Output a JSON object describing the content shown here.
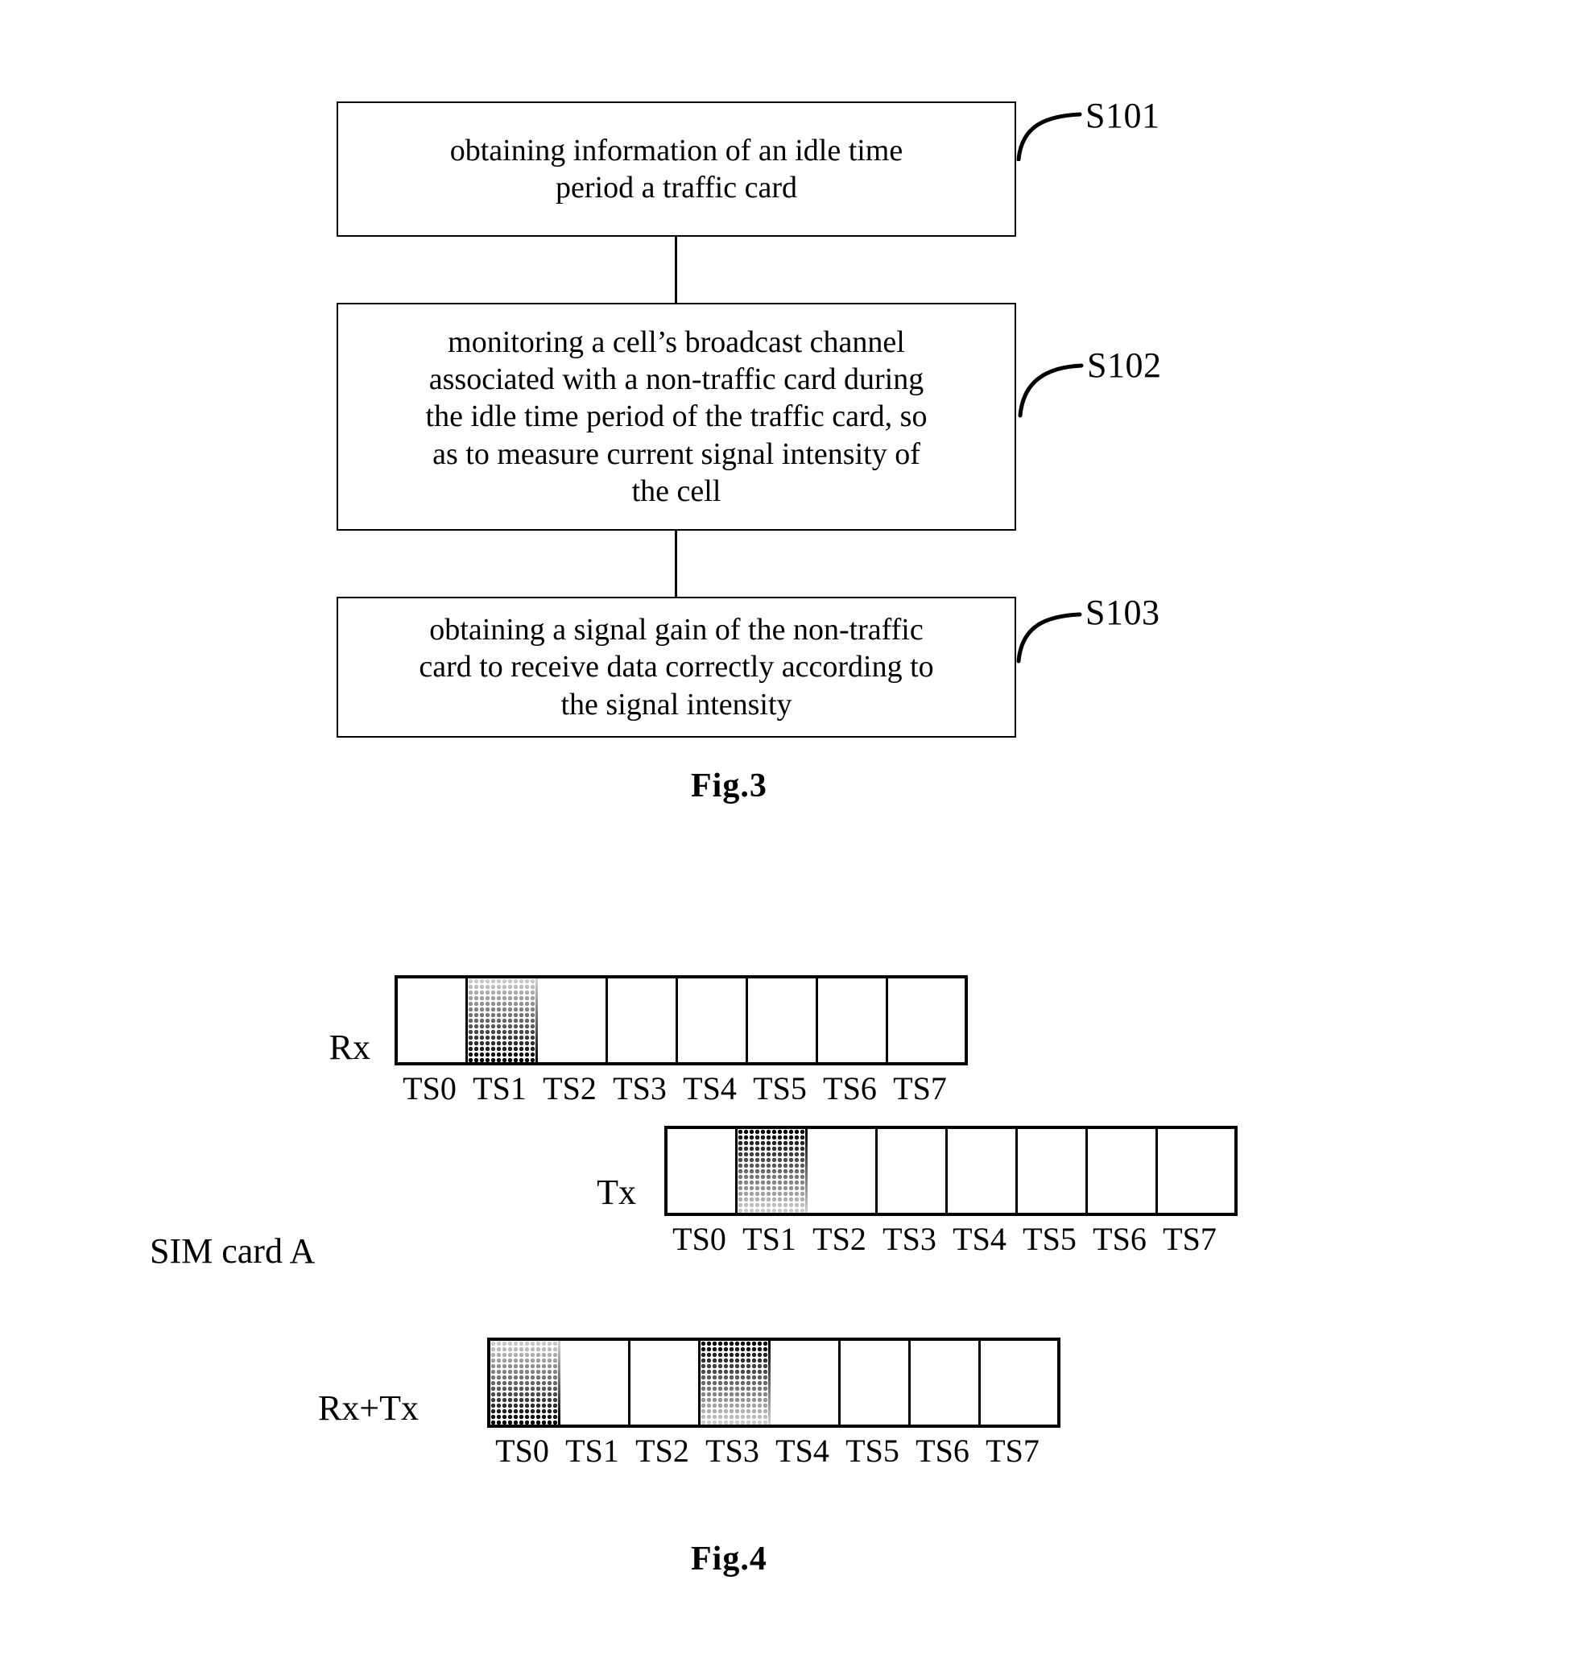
{
  "figure3": {
    "caption": "Fig.3",
    "steps": [
      {
        "id": "S101",
        "label": "S101",
        "lines": [
          "obtaining information of an idle time",
          "period a traffic card"
        ]
      },
      {
        "id": "S102",
        "label": "S102",
        "lines": [
          "monitoring a cell’s broadcast channel",
          "associated with a non-traffic card during",
          "the idle time period of the traffic card, so",
          "as to measure current signal intensity of",
          "the cell"
        ]
      },
      {
        "id": "S103",
        "label": "S103",
        "lines": [
          "obtaining a signal gain of the non-traffic",
          "card to receive data correctly according to",
          "the signal intensity"
        ]
      }
    ]
  },
  "figure4": {
    "caption": "Fig.4",
    "group_label": "SIM card A",
    "timeslot_labels": [
      "TS0",
      "TS1",
      "TS2",
      "TS3",
      "TS4",
      "TS5",
      "TS6",
      "TS7"
    ],
    "rows": [
      {
        "name": "Rx",
        "label": "Rx",
        "shaded": [
          {
            "index": 1,
            "style": "light-to-dark"
          }
        ]
      },
      {
        "name": "Tx",
        "label": "Tx",
        "shaded": [
          {
            "index": 1,
            "style": "dark-to-light"
          }
        ]
      },
      {
        "name": "RxTx",
        "label": "Rx+Tx",
        "shaded": [
          {
            "index": 0,
            "style": "light-to-dark"
          },
          {
            "index": 3,
            "style": "dark-to-light"
          }
        ]
      }
    ]
  },
  "colors": {
    "ink": "#000000",
    "paper": "#ffffff"
  }
}
